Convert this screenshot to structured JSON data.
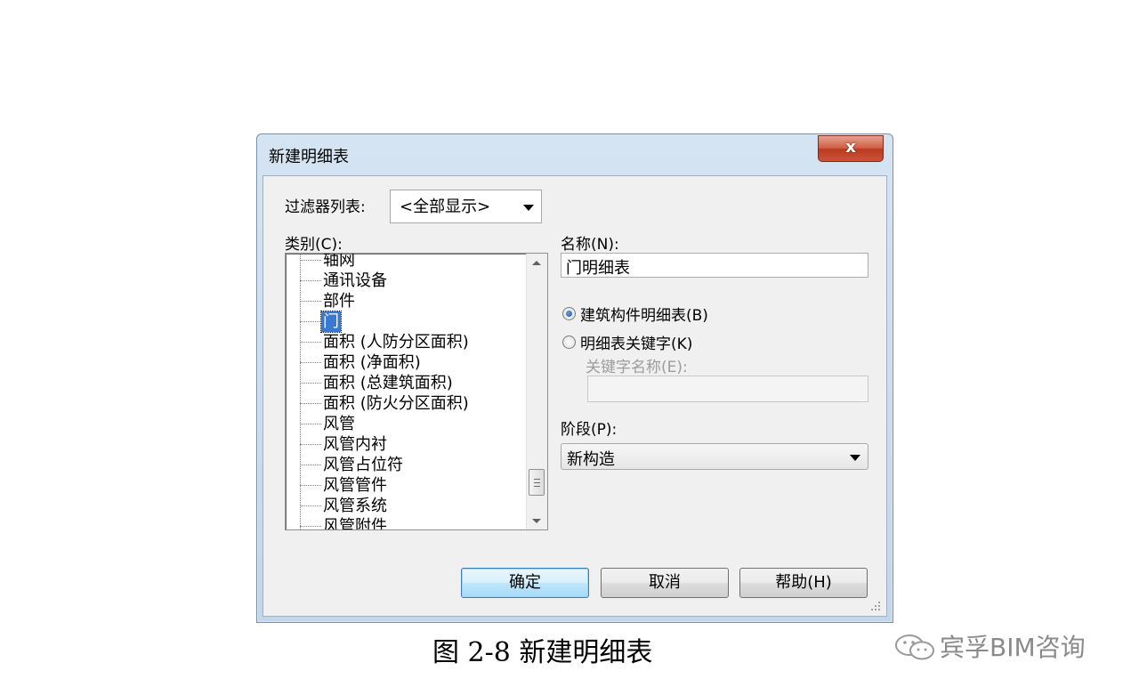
{
  "dialog": {
    "title": "新建明细表",
    "close_symbol": "x",
    "filter_label": "过滤器列表:",
    "filter_value": "<全部显示>",
    "category_label": "类别(C):",
    "categories": [
      {
        "label": "轴网"
      },
      {
        "label": "通讯设备"
      },
      {
        "label": "部件"
      },
      {
        "label": "门",
        "selected": true
      },
      {
        "label": "面积 (人防分区面积)"
      },
      {
        "label": "面积 (净面积)"
      },
      {
        "label": "面积 (总建筑面积)"
      },
      {
        "label": "面积 (防火分区面积)"
      },
      {
        "label": "风管"
      },
      {
        "label": "风管内衬"
      },
      {
        "label": "风管占位符"
      },
      {
        "label": "风管管件"
      },
      {
        "label": "风管系统"
      },
      {
        "label": "风管附件"
      }
    ],
    "name_label": "名称(N):",
    "name_value": "门明细表",
    "radio_building": "建筑构件明细表(B)",
    "radio_key": "明细表关键字(K)",
    "key_name_label": "关键字名称(E):",
    "key_name_value": "",
    "phase_label": "阶段(P):",
    "phase_value": "新构造",
    "buttons": {
      "ok": "确定",
      "cancel": "取消",
      "help": "帮助(H)"
    }
  },
  "caption": "图 2-8 新建明细表",
  "watermark": "宾孚BIM咨询",
  "colors": {
    "title_gradient_top": "#d5e4f2",
    "selection": "#3a78d2",
    "close_button": "#c8553a"
  }
}
